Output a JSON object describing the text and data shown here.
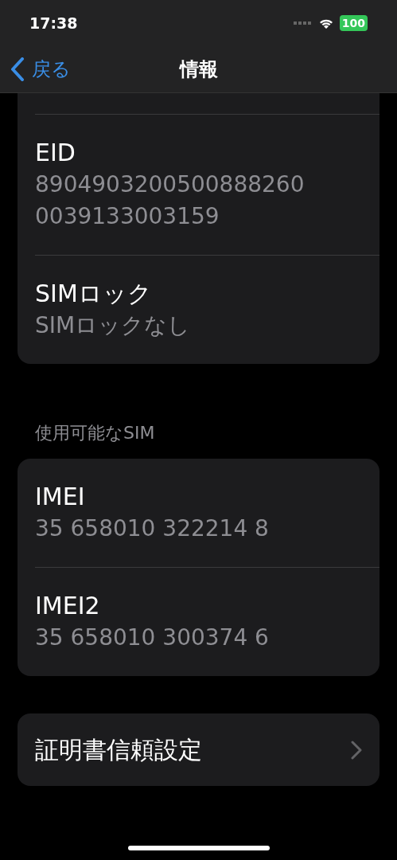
{
  "status_bar": {
    "time": "17:38",
    "battery": "100"
  },
  "nav": {
    "back": "戻る",
    "title": "情報"
  },
  "sections": [
    {
      "rows": [
        {
          "label": "EID",
          "value": "89049032005008882600039133003159"
        },
        {
          "label": "SIMロック",
          "value": "SIMロックなし"
        }
      ]
    },
    {
      "header": "使用可能なSIM",
      "rows": [
        {
          "label": "IMEI",
          "value": "35 658010 322214 8"
        },
        {
          "label": "IMEI2",
          "value": "35 658010 300374 6"
        }
      ]
    }
  ],
  "link_row": {
    "label": "証明書信頼設定"
  }
}
